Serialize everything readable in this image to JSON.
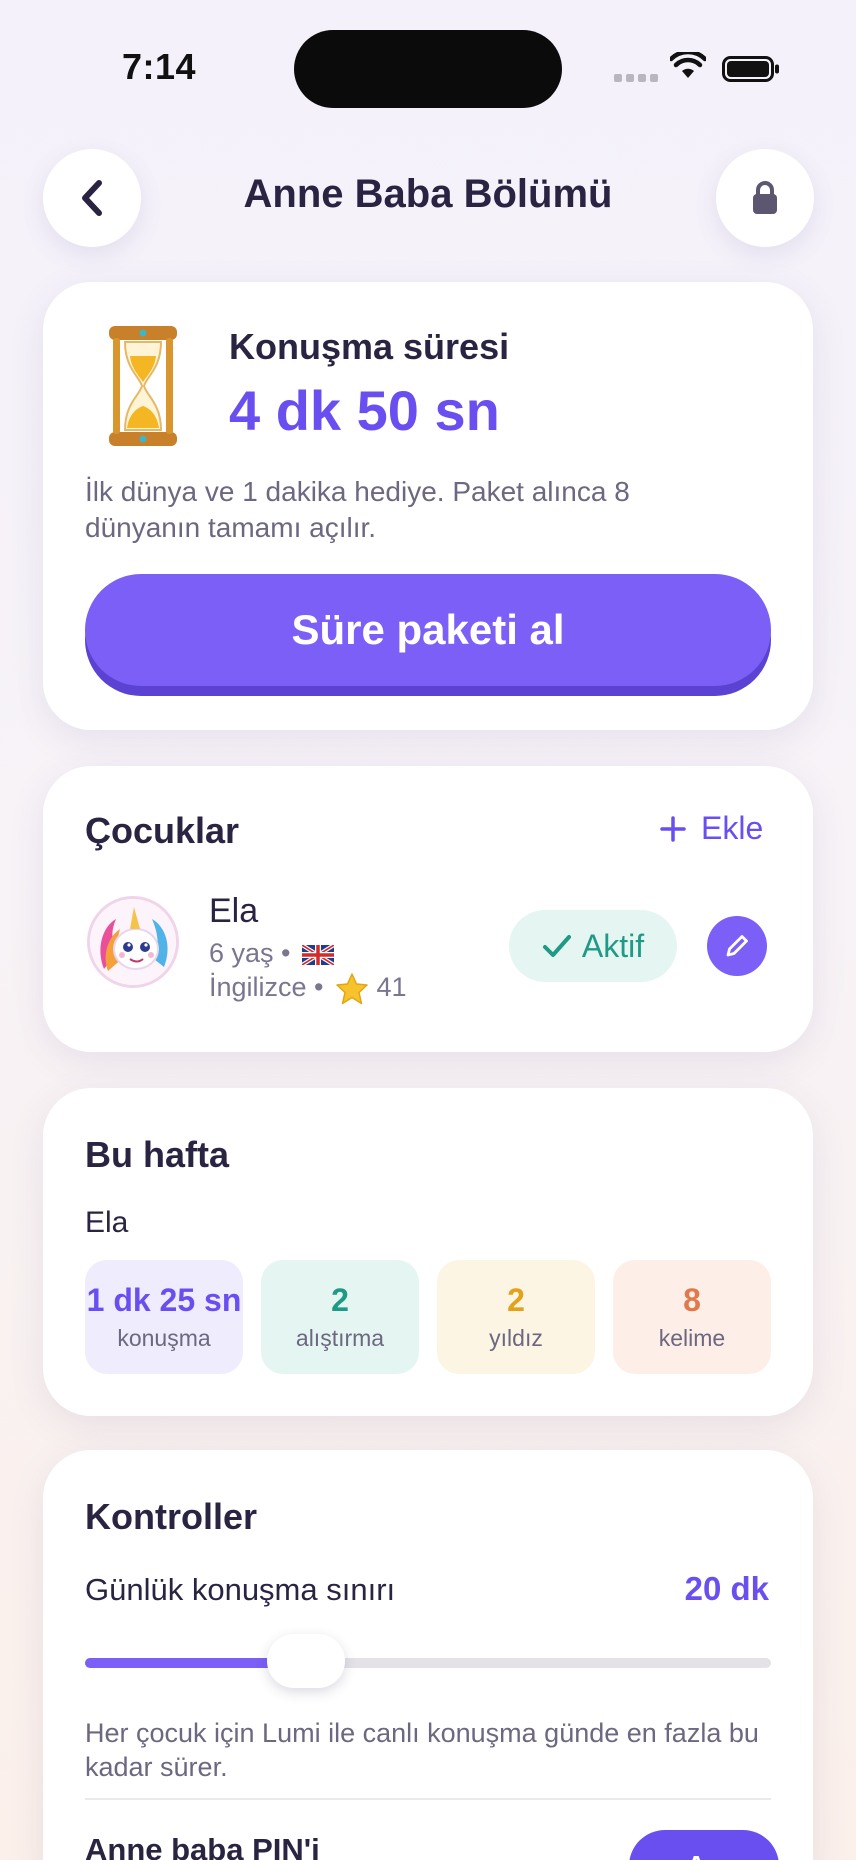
{
  "status": {
    "time": "7:14"
  },
  "header": {
    "title": "Anne Baba Bölümü"
  },
  "talk_card": {
    "label": "Konuşma süresi",
    "value": "4 dk 50 sn",
    "note": "İlk dünya ve 1 dakika hediye. Paket alınca 8 dünyanın tamamı açılır.",
    "buy_label": "Süre paketi al"
  },
  "kids_card": {
    "title": "Çocuklar",
    "add_label": "Ekle",
    "kid": {
      "name": "Ela",
      "age": "6 yaş •",
      "language": "İngilizce •",
      "stars": "41",
      "status": "Aktif"
    }
  },
  "week_card": {
    "title": "Bu hafta",
    "kid_name": "Ela",
    "stats": [
      {
        "value": "1 dk 25 sn",
        "label": "konuşma"
      },
      {
        "value": "2",
        "label": "alıştırma"
      },
      {
        "value": "2",
        "label": "yıldız"
      },
      {
        "value": "8",
        "label": "kelime"
      }
    ]
  },
  "controls_card": {
    "title": "Kontroller",
    "limit_label": "Günlük konuşma sınırı",
    "limit_value": "20 dk",
    "limit_fraction": 0.3,
    "limit_note": "Her çocuk için Lumi ile canlı konuşma günde en fazla bu kadar sürer.",
    "pin_label": "Anne baba PIN'i",
    "pin_button": "Aç"
  },
  "colors": {
    "accent": "#7b5ff6",
    "success": "#1f9a86",
    "star": "#e3a21a",
    "word": "#e07a4d"
  }
}
